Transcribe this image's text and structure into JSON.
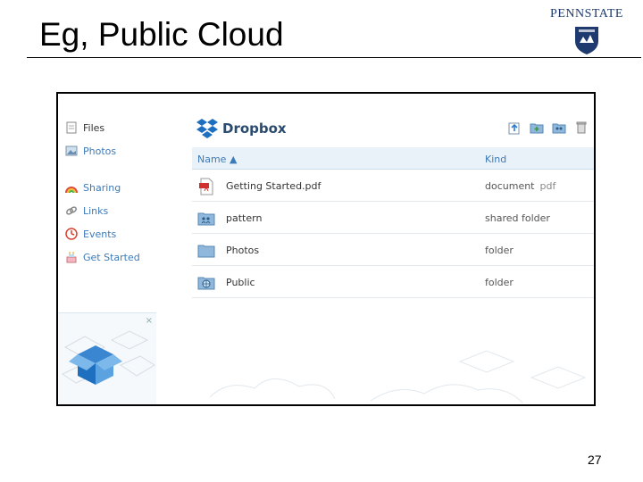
{
  "slide": {
    "title": "Eg, Public Cloud",
    "logo_text": "PENNSTATE",
    "page_number": "27"
  },
  "sidebar": {
    "items": [
      {
        "label": "Files",
        "icon": "files-icon"
      },
      {
        "label": "Photos",
        "icon": "photos-icon"
      },
      {
        "label": "Sharing",
        "icon": "sharing-icon"
      },
      {
        "label": "Links",
        "icon": "links-icon"
      },
      {
        "label": "Events",
        "icon": "events-icon"
      },
      {
        "label": "Get Started",
        "icon": "get-started-icon"
      }
    ],
    "promo_close": "×"
  },
  "header": {
    "brand": "Dropbox"
  },
  "table": {
    "columns": {
      "name": "Name ▲",
      "kind": "Kind"
    },
    "rows": [
      {
        "name": "Getting Started.pdf",
        "kind": "document",
        "ext": "pdf",
        "icon": "pdf-file-icon"
      },
      {
        "name": "pattern",
        "kind": "shared folder",
        "ext": "",
        "icon": "shared-folder-icon"
      },
      {
        "name": "Photos",
        "kind": "folder",
        "ext": "",
        "icon": "photos-folder-icon"
      },
      {
        "name": "Public",
        "kind": "folder",
        "ext": "",
        "icon": "public-folder-icon"
      }
    ]
  },
  "colors": {
    "accent": "#3d7ab8",
    "header_bg": "#e9f2f8",
    "folder": "#8fb8dc",
    "brand_blue": "#1f6fc1"
  }
}
